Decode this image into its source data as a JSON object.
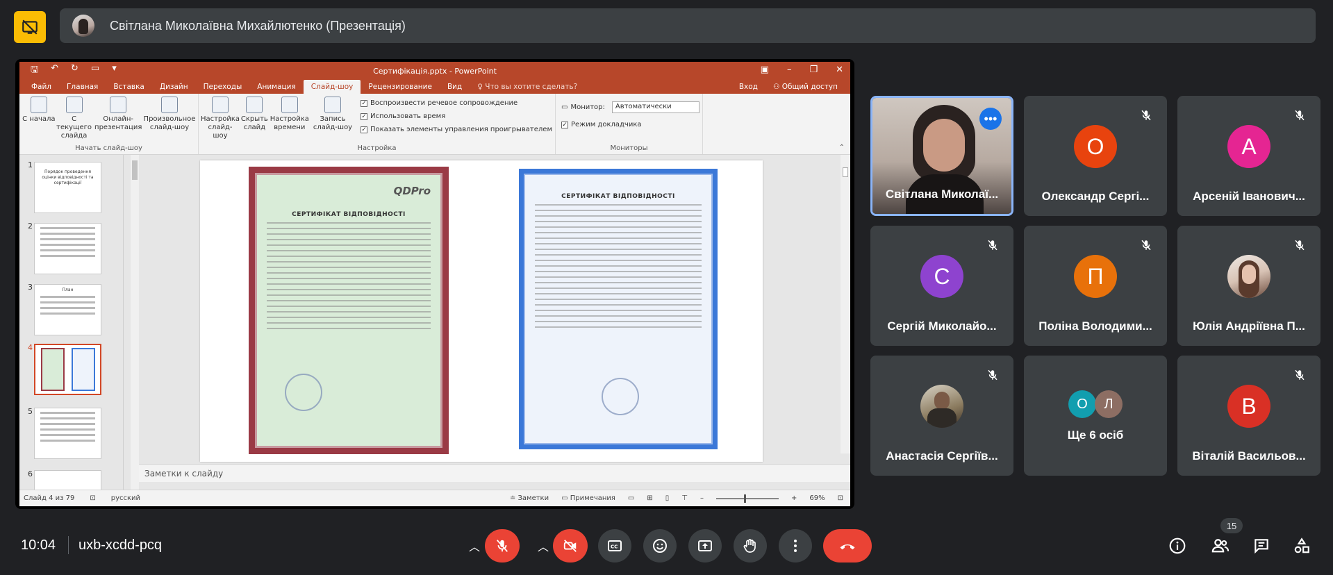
{
  "presenter": {
    "name": "Світлана Миколаївна Михайлютенко (Презентація)"
  },
  "powerpoint": {
    "window_title": "Сертифікація.pptx - PowerPoint",
    "tabs": [
      "Файл",
      "Главная",
      "Вставка",
      "Дизайн",
      "Переходы",
      "Анимация",
      "Слайд-шоу",
      "Рецензирование",
      "Вид"
    ],
    "active_tab": "Слайд-шоу",
    "tell_me": "Что вы хотите сделать?",
    "sign_in": "Вход",
    "share": "Общий доступ",
    "ribbon": {
      "start_group": {
        "label": "Начать слайд-шоу",
        "buttons": [
          "С начала",
          "С текущего слайда",
          "Онлайн-презентация",
          "Произвольное слайд-шоу"
        ]
      },
      "setup_group": {
        "label": "Настройка",
        "buttons": [
          "Настройка слайд-шоу",
          "Скрыть слайд",
          "Настройка времени",
          "Запись слайд-шоу"
        ],
        "checks": [
          "Воспроизвести речевое сопровождение",
          "Использовать время",
          "Показать элементы управления проигрывателем"
        ]
      },
      "monitors_group": {
        "label": "Мониторы",
        "monitor_label": "Монитор:",
        "monitor_value": "Автоматически",
        "presenter_view": "Режим докладчика"
      }
    },
    "thumbnails": [
      {
        "num": "1",
        "text": "Порядок проведення оцінки відповідності та сертифікації"
      },
      {
        "num": "2",
        "text": ""
      },
      {
        "num": "3",
        "text": "План"
      },
      {
        "num": "4",
        "text": ""
      },
      {
        "num": "5",
        "text": ""
      },
      {
        "num": "6",
        "text": ""
      }
    ],
    "slide": {
      "cert1_title": "СЕРТИФІКАТ ВІДПОВІДНОСТІ",
      "cert1_logo": "QDPro",
      "cert2_title": "СЕРТИФІКАТ ВІДПОВІДНОСТІ"
    },
    "notes_placeholder": "Заметки к слайду",
    "status": {
      "slide_counter": "Слайд 4 из 79",
      "language": "русский",
      "notes": "Заметки",
      "comments": "Примечания",
      "zoom": "69%"
    }
  },
  "participants": [
    {
      "name": "Світлана Миколаї...",
      "initial": "",
      "color": "",
      "speaking": true,
      "muted": false,
      "type": "video"
    },
    {
      "name": "Олександр Сергі...",
      "initial": "О",
      "color": "#e8430e",
      "speaking": false,
      "muted": true,
      "type": "letter"
    },
    {
      "name": "Арсеній Іванович...",
      "initial": "А",
      "color": "#e52592",
      "speaking": false,
      "muted": true,
      "type": "letter"
    },
    {
      "name": "Сергій Миколайо...",
      "initial": "С",
      "color": "#8e43cf",
      "speaking": false,
      "muted": true,
      "type": "letter"
    },
    {
      "name": "Поліна Володими...",
      "initial": "П",
      "color": "#e8710a",
      "speaking": false,
      "muted": true,
      "type": "letter"
    },
    {
      "name": "Юлія Андріївна П...",
      "initial": "",
      "color": "",
      "speaking": false,
      "muted": true,
      "type": "photo"
    },
    {
      "name": "Анастасія Сергіїв...",
      "initial": "",
      "color": "",
      "speaking": false,
      "muted": true,
      "type": "photo"
    },
    {
      "name": "Ще 6 осіб",
      "initial": "",
      "color": "",
      "speaking": false,
      "muted": false,
      "type": "others",
      "others": [
        {
          "initial": "О",
          "color": "#129eaf"
        },
        {
          "initial": "Л",
          "color": "#8d6e63"
        }
      ]
    },
    {
      "name": "Віталій Васильов...",
      "initial": "В",
      "color": "#d93025",
      "speaking": false,
      "muted": true,
      "type": "letter"
    }
  ],
  "bottom": {
    "time": "10:04",
    "meeting_code": "uxb-xcdd-pcq",
    "participant_count": "15"
  },
  "colors": {
    "background": "#202124",
    "tile": "#3c4043",
    "hangup": "#ea4335",
    "accent": "#8ab4f8",
    "present_button": "#fbbc04"
  }
}
